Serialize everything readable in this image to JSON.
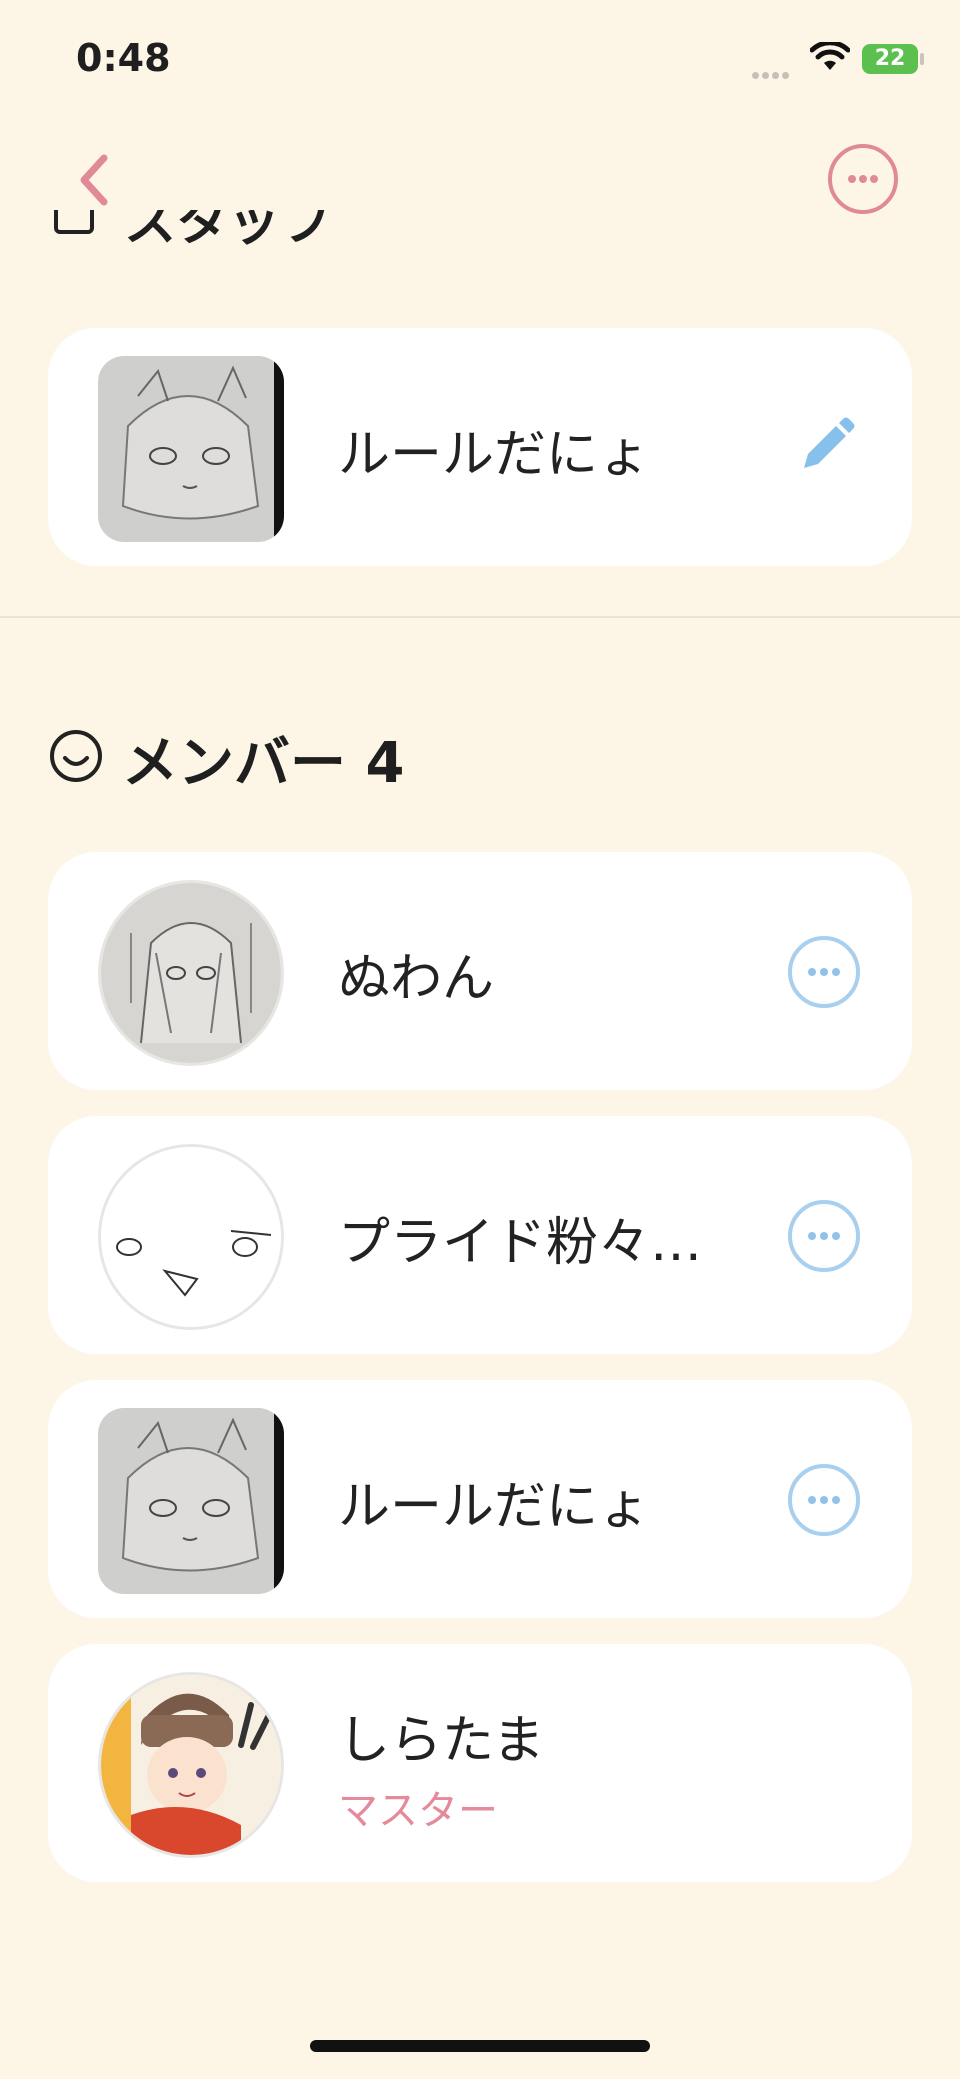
{
  "status_bar": {
    "time": "0:48",
    "battery": "22"
  },
  "header": {
    "back_icon": "chevron-left-icon",
    "more_icon": "ellipsis-circle-icon"
  },
  "previous_section": {
    "title_fragment": "スタッフ"
  },
  "owner_card": {
    "name": "ルールだにょ",
    "action_icon": "pencil-icon"
  },
  "members": {
    "title": "メンバー 4",
    "icon": "smile-face-icon",
    "items": [
      {
        "name": "ぬわん",
        "role": ""
      },
      {
        "name": "プライド粉々…",
        "role": ""
      },
      {
        "name": "ルールだにょ",
        "role": ""
      },
      {
        "name": "しらたま",
        "role": "マスター"
      }
    ]
  },
  "colors": {
    "background": "#fdf6e6",
    "accent_pink": "#e08a98",
    "accent_blue": "#92c2e8",
    "card": "#ffffff"
  }
}
